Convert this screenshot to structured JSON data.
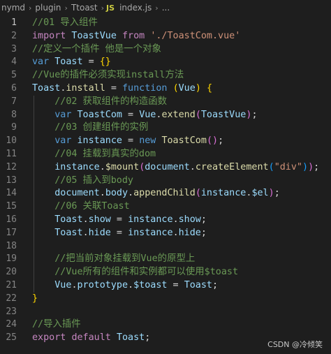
{
  "breadcrumb": {
    "items": [
      "nymd",
      "plugin",
      "Ttoast"
    ],
    "file_icon": "JS",
    "file_name": "index.js",
    "ellipsis": "..."
  },
  "editor": {
    "active_line": 1,
    "lines": [
      {
        "n": "1",
        "tokens": [
          [
            "//01 导入组件",
            "comment"
          ]
        ]
      },
      {
        "n": "2",
        "tokens": [
          [
            "import",
            "ctl"
          ],
          [
            " ToastVue ",
            "var"
          ],
          [
            "from",
            "ctl"
          ],
          [
            " ",
            "op"
          ],
          [
            "'./ToastCom.vue'",
            "str"
          ]
        ]
      },
      {
        "n": "3",
        "tokens": [
          [
            "//定义一个插件 他是一个对象",
            "comment"
          ]
        ]
      },
      {
        "n": "4",
        "tokens": [
          [
            "var",
            "kw"
          ],
          [
            " ",
            "op"
          ],
          [
            "Toast",
            "var"
          ],
          [
            " = ",
            "op"
          ],
          [
            "{}",
            "br1"
          ]
        ]
      },
      {
        "n": "5",
        "tokens": [
          [
            "//Vue的插件必须实现install方法",
            "comment"
          ]
        ]
      },
      {
        "n": "6",
        "tokens": [
          [
            "Toast",
            "var"
          ],
          [
            ".",
            "op"
          ],
          [
            "install",
            "fn"
          ],
          [
            " = ",
            "op"
          ],
          [
            "function",
            "kw"
          ],
          [
            " ",
            "op"
          ],
          [
            "(",
            "br1"
          ],
          [
            "Vue",
            "var"
          ],
          [
            ")",
            "br1"
          ],
          [
            " ",
            "op"
          ],
          [
            "{",
            "br1"
          ]
        ]
      },
      {
        "n": "7",
        "tokens": [
          [
            "    //02 获取组件的构造函数",
            "comment"
          ]
        ]
      },
      {
        "n": "8",
        "tokens": [
          [
            "    ",
            "op"
          ],
          [
            "var",
            "kw"
          ],
          [
            " ",
            "op"
          ],
          [
            "ToastCom",
            "var"
          ],
          [
            " = ",
            "op"
          ],
          [
            "Vue",
            "var"
          ],
          [
            ".",
            "op"
          ],
          [
            "extend",
            "fn"
          ],
          [
            "(",
            "br2"
          ],
          [
            "ToastVue",
            "var"
          ],
          [
            ")",
            "br2"
          ],
          [
            ";",
            "op"
          ]
        ]
      },
      {
        "n": "9",
        "tokens": [
          [
            "    //03 创建组件的实例",
            "comment"
          ]
        ]
      },
      {
        "n": "10",
        "tokens": [
          [
            "    ",
            "op"
          ],
          [
            "var",
            "kw"
          ],
          [
            " ",
            "op"
          ],
          [
            "instance",
            "var"
          ],
          [
            " = ",
            "op"
          ],
          [
            "new",
            "kw"
          ],
          [
            " ",
            "op"
          ],
          [
            "ToastCom",
            "fn"
          ],
          [
            "(",
            "br2"
          ],
          [
            ")",
            "br2"
          ],
          [
            ";",
            "op"
          ]
        ]
      },
      {
        "n": "11",
        "tokens": [
          [
            "    //04 挂载到真实的dom",
            "comment"
          ]
        ]
      },
      {
        "n": "12",
        "tokens": [
          [
            "    ",
            "op"
          ],
          [
            "instance",
            "var"
          ],
          [
            ".",
            "op"
          ],
          [
            "$mount",
            "fn"
          ],
          [
            "(",
            "br2"
          ],
          [
            "document",
            "var"
          ],
          [
            ".",
            "op"
          ],
          [
            "createElement",
            "fn"
          ],
          [
            "(",
            "br3"
          ],
          [
            "\"div\"",
            "str"
          ],
          [
            ")",
            "br3"
          ],
          [
            ")",
            "br2"
          ],
          [
            ";",
            "op"
          ]
        ]
      },
      {
        "n": "13",
        "tokens": [
          [
            "    //05 插入到body",
            "comment"
          ]
        ]
      },
      {
        "n": "14",
        "tokens": [
          [
            "    ",
            "op"
          ],
          [
            "document",
            "var"
          ],
          [
            ".",
            "op"
          ],
          [
            "body",
            "var"
          ],
          [
            ".",
            "op"
          ],
          [
            "appendChild",
            "fn"
          ],
          [
            "(",
            "br2"
          ],
          [
            "instance",
            "var"
          ],
          [
            ".",
            "op"
          ],
          [
            "$el",
            "var"
          ],
          [
            ")",
            "br2"
          ],
          [
            ";",
            "op"
          ]
        ]
      },
      {
        "n": "15",
        "tokens": [
          [
            "    //06 关联Toast",
            "comment"
          ]
        ]
      },
      {
        "n": "16",
        "tokens": [
          [
            "    ",
            "op"
          ],
          [
            "Toast",
            "var"
          ],
          [
            ".",
            "op"
          ],
          [
            "show",
            "var"
          ],
          [
            " = ",
            "op"
          ],
          [
            "instance",
            "var"
          ],
          [
            ".",
            "op"
          ],
          [
            "show",
            "var"
          ],
          [
            ";",
            "op"
          ]
        ]
      },
      {
        "n": "17",
        "tokens": [
          [
            "    ",
            "op"
          ],
          [
            "Toast",
            "var"
          ],
          [
            ".",
            "op"
          ],
          [
            "hide",
            "var"
          ],
          [
            " = ",
            "op"
          ],
          [
            "instance",
            "var"
          ],
          [
            ".",
            "op"
          ],
          [
            "hide",
            "var"
          ],
          [
            ";",
            "op"
          ]
        ]
      },
      {
        "n": "18",
        "tokens": []
      },
      {
        "n": "19",
        "tokens": [
          [
            "    //把当前对象挂载到Vue的原型上",
            "comment"
          ]
        ]
      },
      {
        "n": "20",
        "tokens": [
          [
            "    //Vue所有的组件和实例都可以使用$toast",
            "comment"
          ]
        ]
      },
      {
        "n": "21",
        "tokens": [
          [
            "    ",
            "op"
          ],
          [
            "Vue",
            "var"
          ],
          [
            ".",
            "op"
          ],
          [
            "prototype",
            "var"
          ],
          [
            ".",
            "op"
          ],
          [
            "$toast",
            "var"
          ],
          [
            " = ",
            "op"
          ],
          [
            "Toast",
            "var"
          ],
          [
            ";",
            "op"
          ]
        ]
      },
      {
        "n": "22",
        "tokens": [
          [
            "}",
            "br1"
          ]
        ]
      },
      {
        "n": "23",
        "tokens": []
      },
      {
        "n": "24",
        "tokens": [
          [
            "//导入插件",
            "comment"
          ]
        ]
      },
      {
        "n": "25",
        "tokens": [
          [
            "export",
            "ctl"
          ],
          [
            " ",
            "op"
          ],
          [
            "default",
            "ctl"
          ],
          [
            " ",
            "op"
          ],
          [
            "Toast",
            "var"
          ],
          [
            ";",
            "op"
          ]
        ]
      }
    ]
  },
  "watermark": "CSDN @冷倾笑",
  "colors": {
    "background": "#1e1e1e",
    "comment": "#6a9955",
    "keyword": "#569cd6",
    "control": "#c586c0",
    "variable": "#9cdcfe",
    "function": "#dcdcaa",
    "string": "#ce9178"
  }
}
